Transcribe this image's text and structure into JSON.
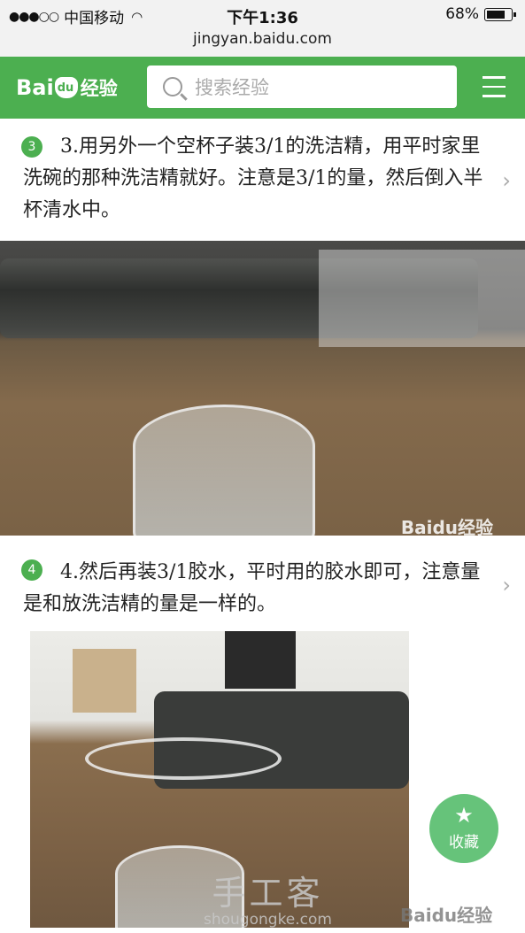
{
  "status_bar": {
    "signal": "●●●○○",
    "carrier": "中国移动",
    "time": "下午1:36",
    "battery": "68%",
    "url": "jingyan.baidu.com"
  },
  "header": {
    "logo_bai": "Bai",
    "logo_du": "du",
    "logo_jingyan": "经验",
    "search_placeholder": "搜索经验",
    "colors": {
      "brand": "#4caf50"
    }
  },
  "steps": [
    {
      "number": "3",
      "text": "3.用另外一个空杯子装3/1的洗洁精，用平时家里洗碗的那种洗洁精就好。注意是3/1的量，然后倒入半杯清水中。"
    },
    {
      "number": "4",
      "text": "4.然后再装3/1胶水，平时用的胶水即可，注意量是和放洗洁精的量是一样的。"
    }
  ],
  "image_watermark": "Baidu经验",
  "fab": {
    "label": "收藏",
    "icon": "star-icon"
  },
  "site_watermark": {
    "main": "手工客",
    "domain": "shougongke.com"
  }
}
